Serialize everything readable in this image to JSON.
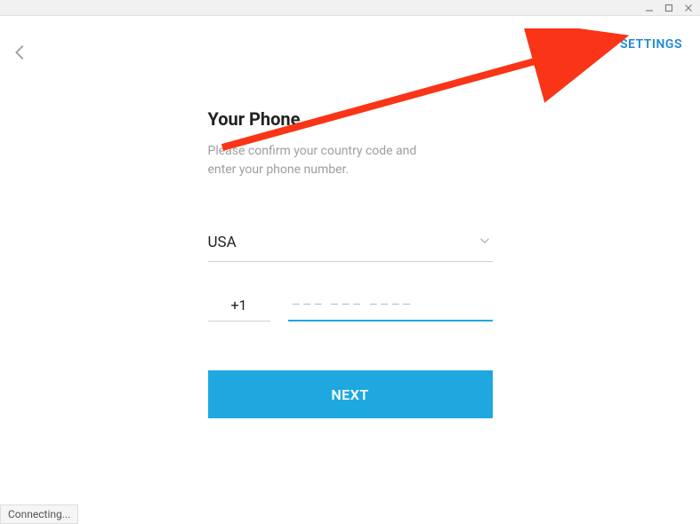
{
  "header": {
    "settings_label": "SETTINGS"
  },
  "form": {
    "title": "Your Phone",
    "subtitle": "Please confirm your country code and enter your phone number.",
    "country": "USA",
    "code": "+1",
    "phone_placeholder": "––– ––– ––––",
    "next_label": "NEXT"
  },
  "status": {
    "text": "Connecting..."
  },
  "colors": {
    "accent": "#1fa8e0",
    "link": "#1e88d2",
    "annotation": "#f93417"
  }
}
